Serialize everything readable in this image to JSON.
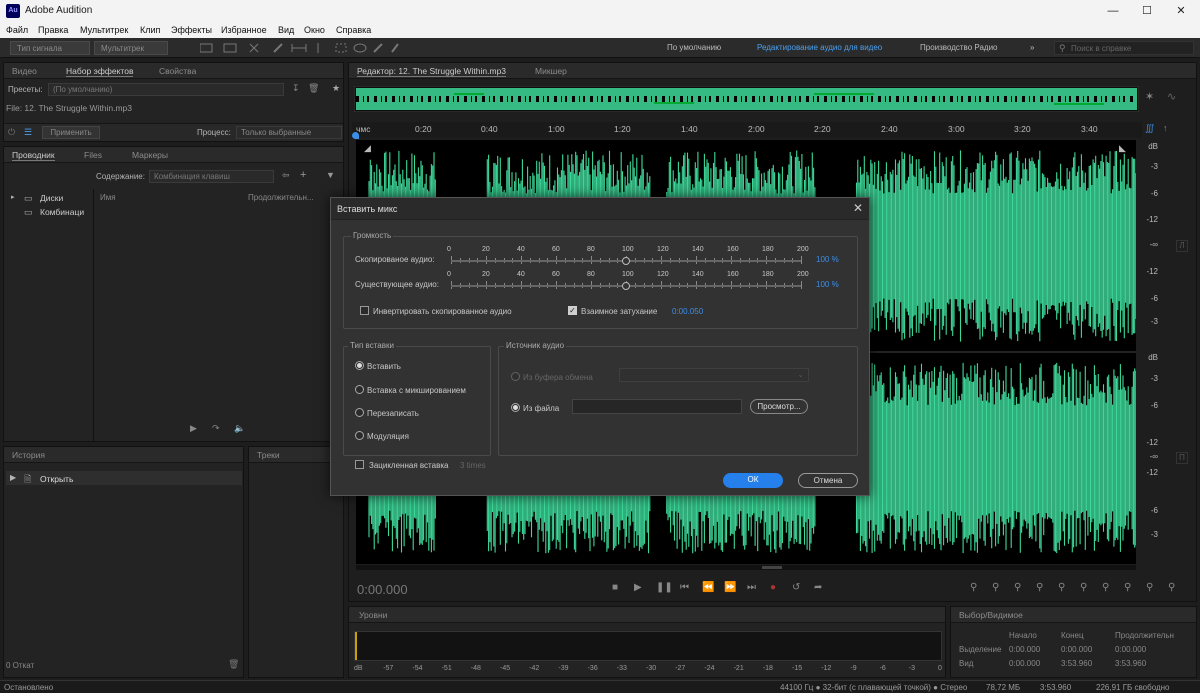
{
  "app": {
    "title": "Adobe Audition",
    "icon_label": "Au"
  },
  "window_controls": [
    "minimize-icon",
    "maximize-icon",
    "close-icon"
  ],
  "menu": [
    "Файл",
    "Правка",
    "Мультитрек",
    "Клип",
    "Эффекты",
    "Избранное",
    "Вид",
    "Окно",
    "Справка"
  ],
  "toolbar": {
    "mode_waveform": "Тип сигнала",
    "mode_multitrack": "Мультитрек",
    "workspaces": [
      "По умолчанию",
      "Редактирование аудио для видео",
      "Производство Радио"
    ],
    "active_workspace": "Редактирование аудио для видео",
    "search_placeholder": "Поиск в справке"
  },
  "effects_panel": {
    "tabs": [
      "Видео",
      "Набор эффектов",
      "Свойства"
    ],
    "active_tab": "Набор эффектов",
    "presets_label": "Пресеты:",
    "presets_value": "(По умолчанию)",
    "file_label": "File: 12. The Struggle Within.mp3",
    "apply_label": "Применить",
    "process_label": "Процесс:",
    "process_value": "Только выбранные"
  },
  "files_panel": {
    "tabs": [
      "Проводник",
      "Files",
      "Маркеры"
    ],
    "content_label": "Содержание:",
    "content_value": "Комбинация клавиш",
    "col_name": "Имя",
    "col_duration": "Продолжительн...",
    "tree": [
      "Диски",
      "Комбинаци"
    ]
  },
  "history_panel": {
    "title": "История",
    "item": "Открыть",
    "undo_count": "0 Откат"
  },
  "tracks_panel": {
    "title": "Треки"
  },
  "editor": {
    "tabs": [
      "Редактор: 12. The Struggle Within.mp3",
      "Микшер"
    ],
    "ruler_labels": [
      "чмс",
      "0:20",
      "0:40",
      "1:00",
      "1:20",
      "1:40",
      "2:00",
      "2:20",
      "2:40",
      "3:00",
      "3:20",
      "3:40"
    ],
    "db_scale_top": [
      "dB",
      "-3",
      "-6",
      "-12",
      "-12",
      "-6",
      "-3"
    ],
    "db_scale_bottom": [
      "dB",
      "-3",
      "-6",
      "-12",
      "-12",
      "-6",
      "-3"
    ],
    "db_inf": "-∞",
    "time_display": "0:00.000",
    "waveform_color": "#3ed99a"
  },
  "levels_panel": {
    "title": "Уровни",
    "scale": [
      "dB",
      "-57",
      "-54",
      "-51",
      "-48",
      "-45",
      "-42",
      "-39",
      "-36",
      "-33",
      "-30",
      "-27",
      "-24",
      "-21",
      "-18",
      "-15",
      "-12",
      "-9",
      "-6",
      "-3",
      "0"
    ]
  },
  "selection_panel": {
    "title": "Выбор/Видимое",
    "headers": [
      "Начало",
      "Конец",
      "Продолжительн"
    ],
    "rows": [
      {
        "label": "Выделение",
        "start": "0:00.000",
        "end": "0:00.000",
        "duration": "0:00.000"
      },
      {
        "label": "Вид",
        "start": "0:00.000",
        "end": "3:53.960",
        "duration": "3:53.960"
      }
    ]
  },
  "status": {
    "left": "Остановлено",
    "format": "44100 Гц ● 32-бит (с плавающей точкой) ● Стерео",
    "size": "78,72 МБ",
    "duration": "3:53.960",
    "free": "226,91 ГБ свободно"
  },
  "dialog": {
    "title": "Вставить микс",
    "volume_group": "Громкость",
    "copied_label": "Скопированое аудио:",
    "existing_label": "Существующее аудио:",
    "scale": [
      "0",
      "20",
      "40",
      "60",
      "80",
      "100",
      "120",
      "140",
      "160",
      "180",
      "200"
    ],
    "copied_value": "100 %",
    "existing_value": "100 %",
    "copied_level": 100,
    "existing_level": 100,
    "invert_label": "Инвертировать скопированное аудио",
    "invert_checked": false,
    "crossfade_label": "Взаимное затухание",
    "crossfade_checked": true,
    "crossfade_value": "0:00.050",
    "paste_type_group": "Тип вставки",
    "paste_types": [
      "Вставить",
      "Вставка с микшированием",
      "Перезаписать",
      "Модуляция"
    ],
    "selected_paste_type": "Вставить",
    "source_group": "Источник аудио",
    "from_clipboard": "Из буфера обмена",
    "from_file": "Из файла",
    "browse": "Просмотр...",
    "loop_label": "Зацикленная вставка",
    "loop_times": "3 times",
    "ok": "ОК",
    "cancel": "Отмена"
  }
}
